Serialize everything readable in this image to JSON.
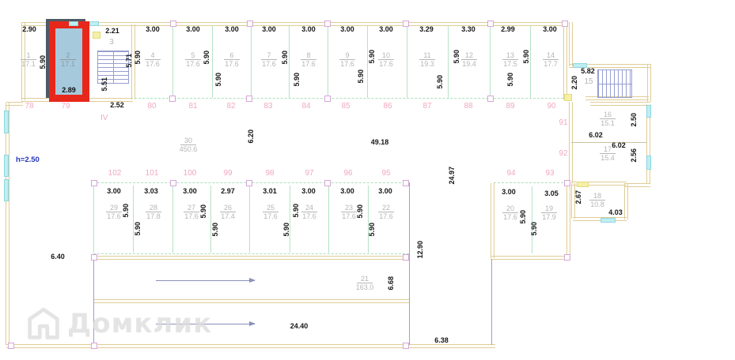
{
  "plan": {
    "section_label": "IV",
    "height_note": "h=2.50"
  },
  "highlight": {
    "no": "2",
    "area": "17.1",
    "width": "2.89"
  },
  "units": {
    "u1": {
      "no": "1",
      "area": "17.1"
    },
    "u3": {
      "no": "3"
    },
    "u4": {
      "no": "4",
      "area": "17.6"
    },
    "u5": {
      "no": "5",
      "area": "17.6"
    },
    "u6": {
      "no": "6",
      "area": "17.6"
    },
    "u7": {
      "no": "7",
      "area": "17.6"
    },
    "u8": {
      "no": "8",
      "area": "17.6"
    },
    "u9": {
      "no": "9",
      "area": "17.6"
    },
    "u10": {
      "no": "10",
      "area": "17.6"
    },
    "u11": {
      "no": "11",
      "area": "19.3"
    },
    "u12": {
      "no": "12",
      "area": "19.4"
    },
    "u13": {
      "no": "13",
      "area": "17.5"
    },
    "u14": {
      "no": "14",
      "area": "17.7"
    },
    "u15": {
      "no": "15"
    },
    "u16": {
      "no": "16",
      "area": "15.1"
    },
    "u17": {
      "no": "17",
      "area": "15.4"
    },
    "u18": {
      "no": "18",
      "area": "10.8"
    },
    "u19": {
      "no": "19",
      "area": "17.9"
    },
    "u20": {
      "no": "20",
      "area": "17.6"
    },
    "u21": {
      "no": "21",
      "area": "163.0"
    },
    "u22": {
      "no": "22",
      "area": "17.6"
    },
    "u23": {
      "no": "23",
      "area": "17.6"
    },
    "u24": {
      "no": "24",
      "area": "17.6"
    },
    "u25": {
      "no": "25",
      "area": "17.6"
    },
    "u26": {
      "no": "26",
      "area": "17.4"
    },
    "u27": {
      "no": "27",
      "area": "17.6"
    },
    "u28": {
      "no": "28",
      "area": "17.8"
    },
    "u29": {
      "no": "29",
      "area": "17.6"
    },
    "u30": {
      "no": "30",
      "area": "450.6"
    }
  },
  "dims": {
    "d290": "2.90",
    "d221": "2.21",
    "d252": "2.52",
    "d300": "3.00",
    "d329": "3.29",
    "d330": "3.30",
    "d299": "2.99",
    "d303": "3.03",
    "d297": "2.97",
    "d301": "3.01",
    "d305": "3.05",
    "d590": "5.90",
    "d571": "5.71",
    "d551": "5.51",
    "d582": "5.82",
    "d220": "2.20",
    "d602": "6.02",
    "d250": "2.50",
    "d256": "2.56",
    "d267": "2.67",
    "d403": "4.03",
    "d620": "6.20",
    "d4918": "49.18",
    "d2497": "24.97",
    "d1290": "12.90",
    "d640": "6.40",
    "d668": "6.68",
    "d2440": "24.40",
    "d638": "6.38"
  },
  "grid": {
    "g78": "78",
    "g79": "79",
    "g80": "80",
    "g81": "81",
    "g82": "82",
    "g83": "83",
    "g84": "84",
    "g85": "85",
    "g86": "86",
    "g87": "87",
    "g88": "88",
    "g89": "89",
    "g90": "90",
    "g91": "91",
    "g92": "92",
    "g93": "93",
    "g94": "94",
    "g95": "95",
    "g96": "96",
    "g97": "97",
    "g98": "98",
    "g99": "99",
    "g100": "100",
    "g101": "101",
    "g102": "102"
  },
  "watermark": {
    "text": "Домклик"
  }
}
